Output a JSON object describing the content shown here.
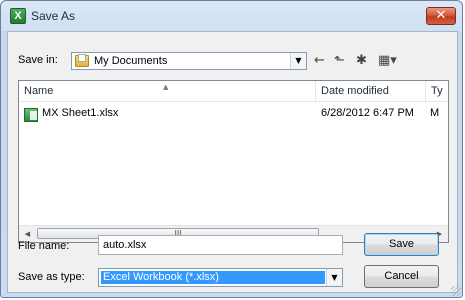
{
  "window": {
    "title": "Save As",
    "app_icon": "excel-icon",
    "close_icon": "close-icon",
    "close_glyph": "✕"
  },
  "toolbar": {
    "save_in_label": "Save in:",
    "save_in_value": "My Documents",
    "combo_arrow": "▼",
    "icons": [
      {
        "name": "back-icon",
        "glyph": "←"
      },
      {
        "name": "up-folder-icon",
        "glyph": "⬑"
      },
      {
        "name": "new-folder-icon",
        "glyph": "✱"
      },
      {
        "name": "views-menu-icon",
        "glyph": "▦▾"
      }
    ]
  },
  "file_list": {
    "columns": [
      "Name",
      "Date modified",
      "Ty"
    ],
    "sort_indicator": "▲",
    "rows": [
      {
        "name": "MX Sheet1.xlsx",
        "date_modified": "6/28/2012 6:47 PM",
        "type": "M",
        "icon": "excel-file-icon"
      }
    ],
    "scroll": {
      "left": "◀",
      "right": "▶",
      "thumb": "III"
    }
  },
  "file_name": {
    "label": "File name:",
    "value": "auto.xlsx"
  },
  "save_as_type": {
    "label": "Save as type:",
    "value": "Excel Workbook (*.xlsx)"
  },
  "buttons": {
    "save": "Save",
    "cancel": "Cancel"
  },
  "colors": {
    "selection": "#3399ff",
    "close_button": "#c94a2f",
    "title_bar": "#cfe0f3"
  }
}
